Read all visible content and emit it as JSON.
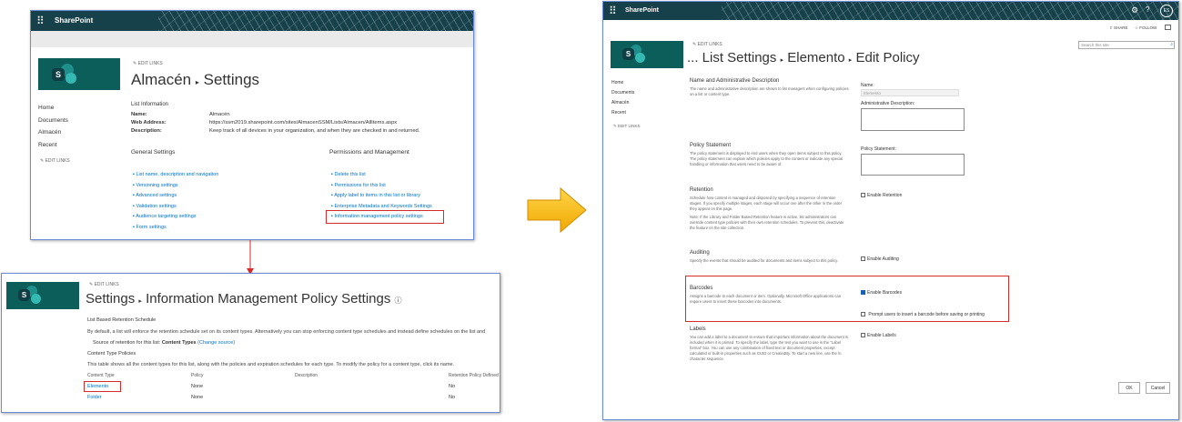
{
  "colors": {
    "suitebar": "#16404a",
    "accent_link": "#0072c6",
    "highlight": "#d62b2b",
    "arrow": "#f6b600"
  },
  "common": {
    "brand": "SharePoint",
    "edit_links": "EDIT LINKS",
    "waffle_icon": "waffle-icon"
  },
  "panel1": {
    "nav": [
      "Home",
      "Documents",
      "Almacén",
      "Recent"
    ],
    "title": {
      "site": "Almacén",
      "sep": "▸",
      "page": "Settings"
    },
    "list_info": {
      "heading": "List Information",
      "rows": [
        {
          "label": "Name:",
          "value": "Almacén"
        },
        {
          "label": "Web Address:",
          "value": "https://ssm2019.sharepoint.com/sites/AlmacenSSM/Lists/Almacen/AllItems.aspx"
        },
        {
          "label": "Description:",
          "value": "Keep track of all devices in your organization, and when they are checked in and returned."
        }
      ]
    },
    "general": {
      "heading": "General Settings",
      "links": [
        "List name, description and navigation",
        "Versioning settings",
        "Advanced settings",
        "Validation settings",
        "Audience targeting settings",
        "Form settings"
      ]
    },
    "perm": {
      "heading": "Permissions and Management",
      "links": [
        "Delete this list",
        "Permissions for this list",
        "Apply label to items in this list or library",
        "Enterprise Metadata and Keywords Settings",
        "Information management policy settings"
      ]
    }
  },
  "panel2": {
    "title": {
      "a": "Settings",
      "sep": "▸",
      "b": "Information Management Policy Settings",
      "info": "ⓘ"
    },
    "sched_heading": "List Based Retention Schedule",
    "sched_text": "By default, a list will enforce the retention schedule set on its content types. Alternatively you can stop enforcing content type schedules and instead define schedules on the list and",
    "source_label": "Source of retention for this list:",
    "source_value": "Content Types",
    "source_change": "(Change source)",
    "ctp_heading": "Content Type Policies",
    "ctp_text": "This table shows all the content types for this list, along with the policies and expiration schedules for each type. To modify the policy for a content type, click its name.",
    "columns": [
      "Content Type",
      "Policy",
      "Description",
      "Retention Policy Defined"
    ],
    "rows": [
      {
        "type": "Elemento",
        "policy": "None",
        "desc": "",
        "ret": "No"
      },
      {
        "type": "Folder",
        "policy": "None",
        "desc": "",
        "ret": "No"
      }
    ]
  },
  "panel3": {
    "topbar": {
      "share": "SHARE",
      "follow": "FOLLOW",
      "avatar": "ES"
    },
    "search_placeholder": "Search this site",
    "nav": [
      "Home",
      "Documents",
      "Almacén",
      "Recent"
    ],
    "title": {
      "a": "... List Settings",
      "sep1": "▸",
      "b": "Elemento",
      "sep2": "▸",
      "c": "Edit Policy"
    },
    "sections": {
      "name": {
        "title": "Name and Administrative Description",
        "text": "The name and administrative description are shown to list managers when configuring policies on a list or content type.",
        "name_label": "Name:",
        "name_value": "Elemento",
        "admin_label": "Administrative Description:"
      },
      "policy": {
        "title": "Policy Statement",
        "text": "The policy statement is displayed to end users when they open items subject to this policy. The policy statement can explain which policies apply to the content or indicate any special handling or information that users need to be aware of.",
        "label": "Policy Statement:"
      },
      "retention": {
        "title": "Retention",
        "text": "Schedule how content is managed and disposed by specifying a sequence of retention stages. If you specify multiple stages, each stage will occur one after the other in the order they appear on this page.",
        "note": "Note: If the Library and Folder Based Retention feature is active, list administrators can override content type policies with their own retention schedules. To prevent this, deactivate the feature on the site collection.",
        "checkbox": "Enable Retention"
      },
      "auditing": {
        "title": "Auditing",
        "text": "Specify the events that should be audited for documents and items subject to this policy.",
        "checkbox": "Enable Auditing"
      },
      "barcodes": {
        "title": "Barcodes",
        "text": "Assigns a barcode to each document or item. Optionally, Microsoft Office applications can require users to insert these barcodes into documents.",
        "checkbox": "Enable Barcodes",
        "prompt": "Prompt users to insert a barcode before saving or printing"
      },
      "labels": {
        "title": "Labels",
        "text": "You can add a label to a document to ensure that important information about the document is included when it is printed. To specify the label, type the text you want to use in the \"Label format\" box. You can use any combination of fixed text or document properties, except calculated or built-in properties such as GUID or CreatedBy. To start a new line, use the \\n character sequence.",
        "checkbox": "Enable Labels"
      }
    },
    "ok": "OK",
    "cancel": "Cancel"
  }
}
